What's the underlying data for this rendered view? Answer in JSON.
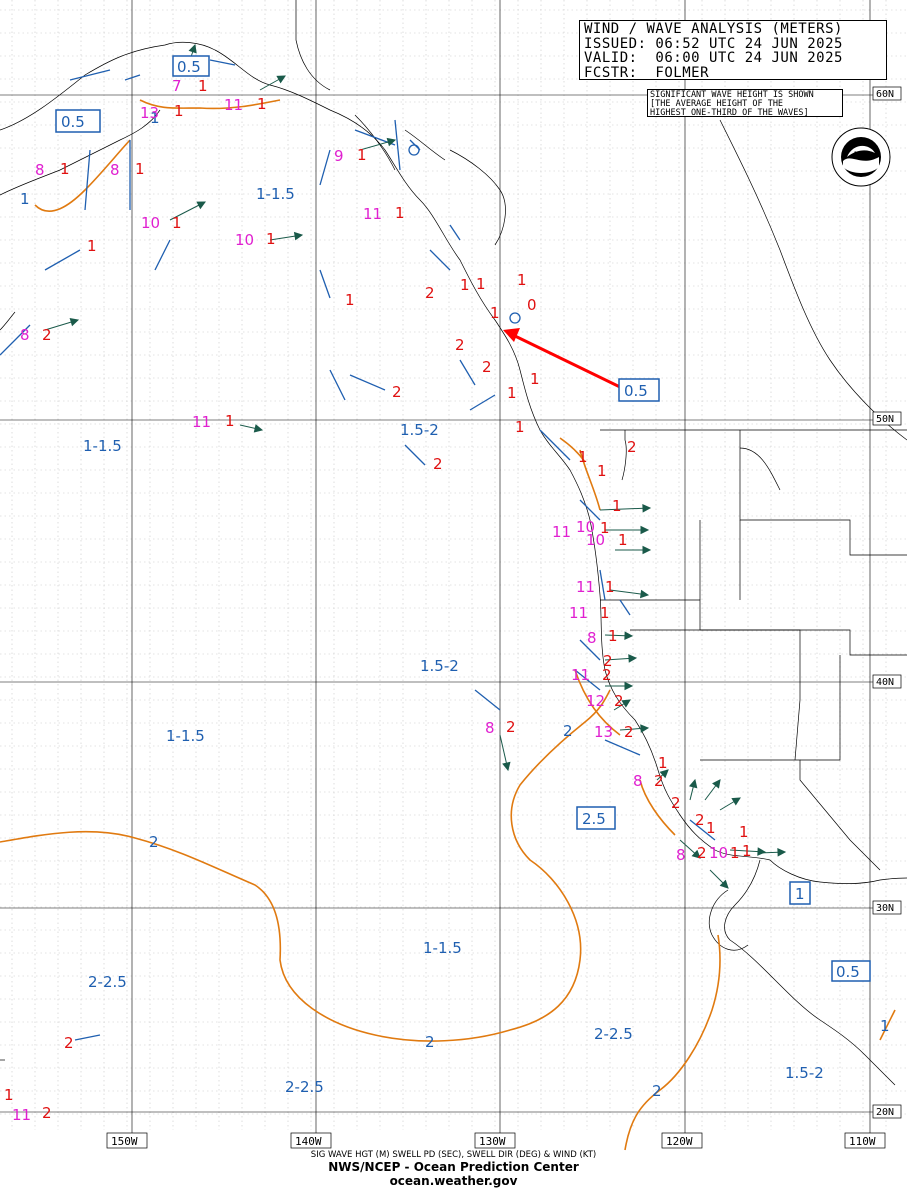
{
  "header": {
    "line1": "WIND / WAVE ANALYSIS (METERS)",
    "line2": "ISSUED: 06:52 UTC 24 JUN 2025",
    "line3": "VALID:  06:00 UTC 24 JUN 2025",
    "line4": "FCSTR:  FOLMER"
  },
  "note": {
    "line1": "SIGNIFICANT WAVE HEIGHT IS SHOWN",
    "line2": "[THE AVERAGE HEIGHT OF THE",
    "line3": "HIGHEST ONE-THIRD OF THE WAVES]"
  },
  "logo": {
    "name": "NOAA",
    "ring_text": "NATIONAL OCEANIC AND ATMOSPHERIC ADMINISTRATION U.S. DEPARTMENT OF COMMERCE"
  },
  "latitudes": [
    "60N",
    "50N",
    "40N",
    "30N",
    "20N"
  ],
  "longitudes": [
    "150W",
    "140W",
    "130W",
    "120W",
    "110W"
  ],
  "footer": {
    "line1": "SIG WAVE HGT (M) SWELL PD (SEC), SWELL DIR (DEG) & WIND (KT)",
    "line2": "NWS/NCEP - Ocean Prediction Center",
    "line3": "ocean.weather.gov"
  },
  "wave_ranges": [
    "1-1.5",
    "1-1.5",
    "1.5-2",
    "1.5-2",
    "1-1.5",
    "1-1.5",
    "2-2.5",
    "2-2.5",
    "2-2.5",
    "1.5-2"
  ],
  "boxed_labels": [
    "0.5",
    "0.5",
    "0.5",
    "2.5",
    "1",
    "0.5"
  ],
  "contour_labels": [
    "2",
    "2",
    "2",
    "2",
    "1",
    "1",
    "1"
  ],
  "heights": [
    "1",
    "1",
    "1",
    "1",
    "1",
    "1",
    "1",
    "2",
    "1",
    "1",
    "1",
    "1",
    "1",
    "2",
    "1",
    "0",
    "2",
    "2",
    "1",
    "2",
    "1",
    "2",
    "2",
    "1",
    "1",
    "1",
    "1",
    "1",
    "1",
    "1",
    "1",
    "1",
    "2",
    "2",
    "2",
    "2",
    "2",
    "2",
    "2",
    "1",
    "1",
    "1",
    "1",
    "2",
    "1",
    "2",
    "1",
    "1",
    "2",
    "1",
    "2",
    "1"
  ],
  "periods": [
    "7",
    "13",
    "11",
    "8",
    "8",
    "9",
    "10",
    "10",
    "8",
    "11",
    "11",
    "11",
    "10",
    "10",
    "11",
    "11",
    "8",
    "11",
    "12",
    "13",
    "8",
    "8",
    "8",
    "10",
    "11"
  ]
}
